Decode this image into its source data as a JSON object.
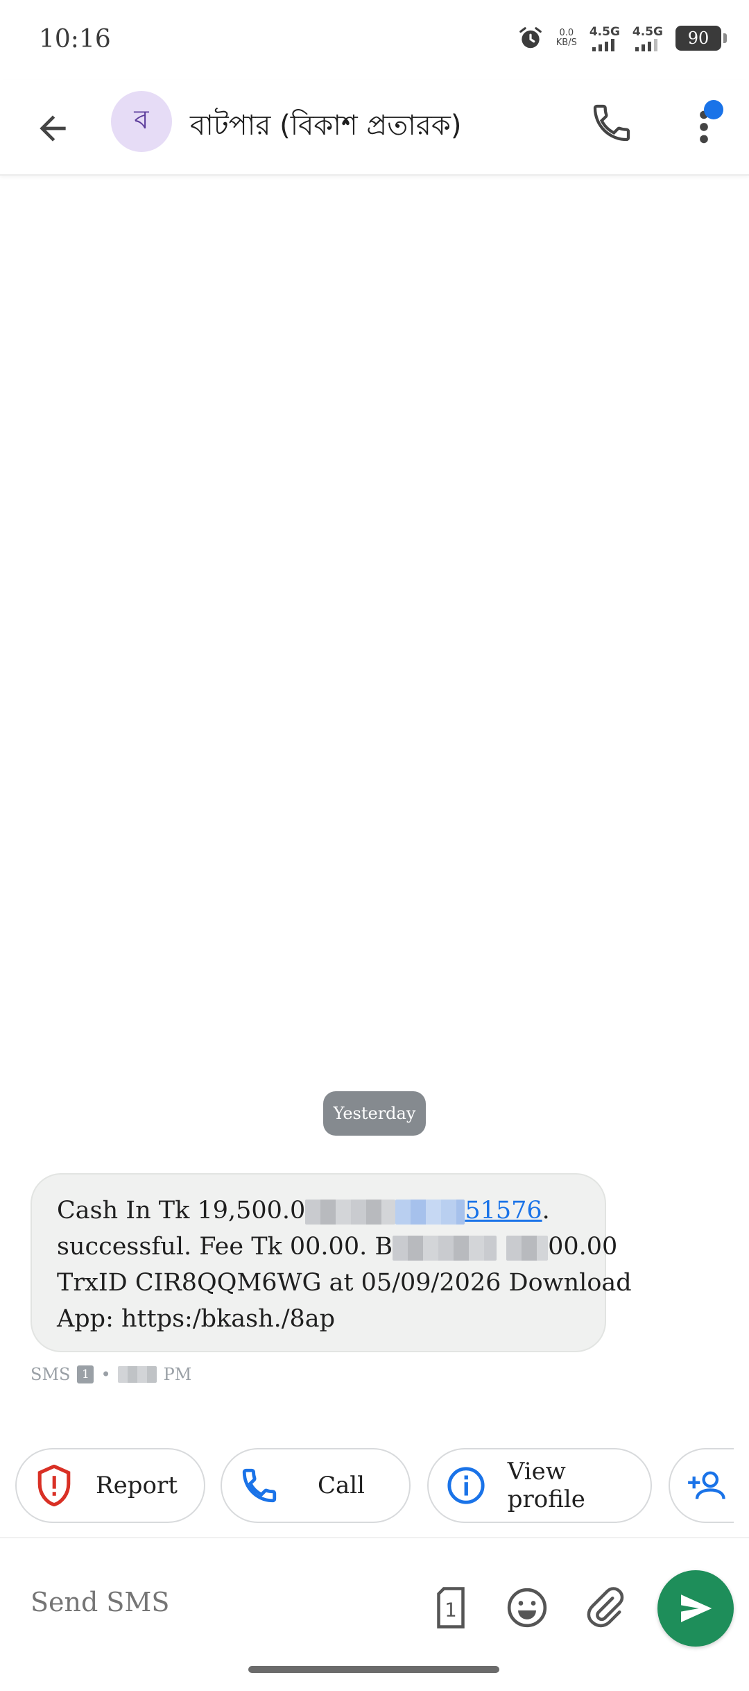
{
  "status_bar": {
    "time": "10:16",
    "net_speed_top": "0.0",
    "net_speed_bottom": "KB/S",
    "sim1_label": "4.5G",
    "sim2_label": "4.5G",
    "battery": "90"
  },
  "header": {
    "avatar_letter": "ব",
    "title": "বাটপার (বিকাশ প্রতারক)"
  },
  "conversation": {
    "date_chip": "Yesterday",
    "message": {
      "line1_prefix": " Cash In Tk 19,500.0",
      "line1_link": "51576",
      "line1_suffix": ".",
      "line2_prefix": "successful. Fee Tk 00.00. B",
      "line2_suffix": "00.00",
      "line3": "TrxID CIR8QQM6WG at 05/09/2026  Download",
      "line4": "App: https:/bkash./8ap"
    },
    "meta": {
      "type": "SMS",
      "sim": "1",
      "separator": "•",
      "time_suffix": "PM"
    }
  },
  "actions": {
    "report": "Report",
    "call": "Call",
    "view_profile": "View profile"
  },
  "composer": {
    "placeholder": "Send SMS",
    "sim_number": "1"
  },
  "colors": {
    "accent": "#1a73e8",
    "send": "#1e8e5a",
    "report": "#d93025",
    "avatar_bg": "#e6dcf6"
  },
  "icons": [
    "back-arrow-icon",
    "phone-icon",
    "more-vert-icon",
    "shield-alert-icon",
    "info-icon",
    "person-add-icon",
    "sim-icon",
    "emoji-icon",
    "attach-icon",
    "send-icon"
  ]
}
